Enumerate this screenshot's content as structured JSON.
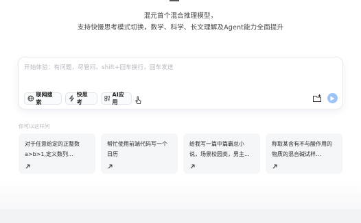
{
  "intro": {
    "line1": "混元首个混合推理模型，",
    "line2": "支持快慢思考模式切换，数学、科学、长文理解及Agent能力全面提升"
  },
  "composer": {
    "placeholder": "开始体验：有问题，尽管问。shift+回车换行，回车发送",
    "chips": {
      "web_search": "联网搜索",
      "fast_think": "快思考",
      "ai_app": "AI应用"
    }
  },
  "suggestions": {
    "label": "你可以这样问",
    "items": [
      {
        "line1": "对于任意给定的正整数",
        "line2": "a>b>1,定义数列..."
      },
      {
        "line1": "帮忙使用前端代码写一个",
        "line2": "日历"
      },
      {
        "line1": "给我写一篇中篇霸总小",
        "line2": "说，场景校园类，男主..."
      },
      {
        "line1": "称取某含有不与酸作用的",
        "line2": "物质的混合碱试样..."
      }
    ]
  },
  "colors": {
    "send_button": "#9cc3f7",
    "card_bg": "#f5f6f8"
  },
  "icons": [
    "globe-icon",
    "lightning-icon",
    "app-grid-icon",
    "pointer-cursor-icon",
    "folder-icon",
    "send-arrow-icon",
    "arrow-up-right-icon"
  ]
}
